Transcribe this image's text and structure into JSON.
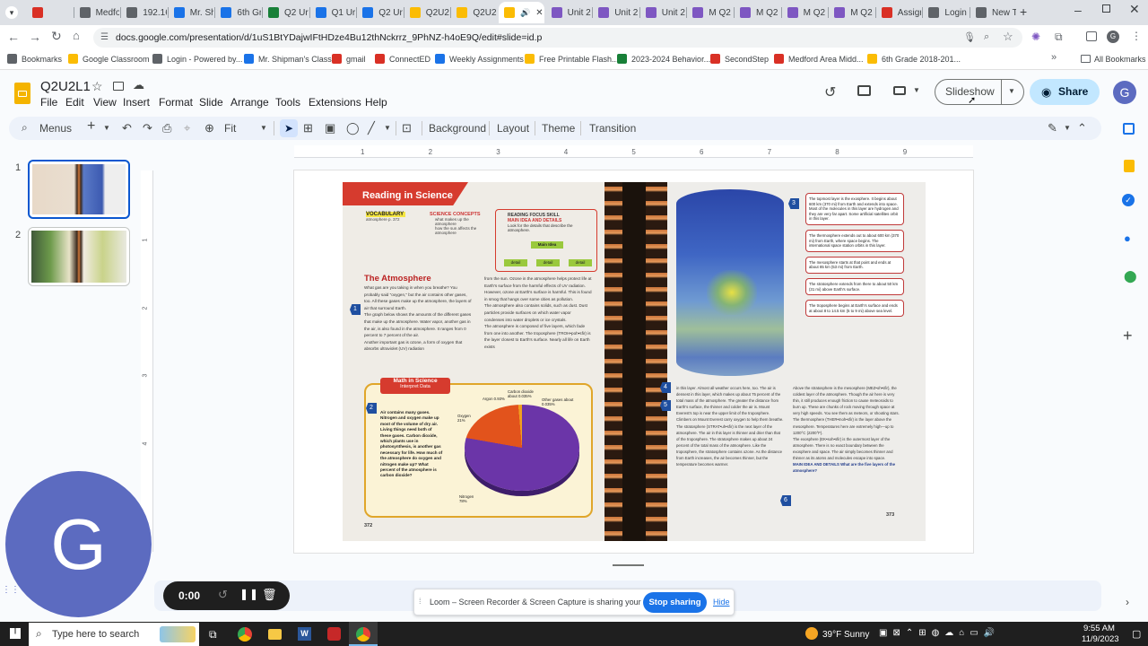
{
  "tabs": [
    {
      "label": "",
      "color": "#d93025"
    },
    {
      "label": "Medfo",
      "color": "#5f6368"
    },
    {
      "label": "192.16",
      "color": "#5f6368"
    },
    {
      "label": "Mr. Sh",
      "color": "#1a73e8"
    },
    {
      "label": "6th Gr",
      "color": "#1a73e8"
    },
    {
      "label": "Q2 Ur",
      "color": "#188038"
    },
    {
      "label": "Q1 Ur",
      "color": "#1a73e8"
    },
    {
      "label": "Q2 Ur",
      "color": "#1a73e8"
    },
    {
      "label": "Q2U2",
      "color": "#fbbc04"
    },
    {
      "label": "Q2U2",
      "color": "#fbbc04"
    },
    {
      "label": "",
      "color": "#fbbc04"
    },
    {
      "label": "Unit 2",
      "color": "#7e57c2"
    },
    {
      "label": "Unit 2",
      "color": "#7e57c2"
    },
    {
      "label": "Unit 2",
      "color": "#7e57c2"
    },
    {
      "label": "M Q2",
      "color": "#7e57c2"
    },
    {
      "label": "M Q2",
      "color": "#7e57c2"
    },
    {
      "label": "M Q2",
      "color": "#7e57c2"
    },
    {
      "label": "M Q2",
      "color": "#7e57c2"
    },
    {
      "label": "Assigr",
      "color": "#d93025"
    },
    {
      "label": "Login",
      "color": "#5f6368"
    },
    {
      "label": "New T",
      "color": "#5f6368"
    }
  ],
  "url": "docs.google.com/presentation/d/1uS1BtYDajwIFtHDze4Bu12thNckrrz_9PhNZ-h4oE9Q/edit#slide=id.p",
  "bookmarks": [
    {
      "label": "Bookmarks",
      "color": "#5f6368"
    },
    {
      "label": "Google Classroom",
      "color": "#fbbc04"
    },
    {
      "label": "Login - Powered by...",
      "color": "#5f6368"
    },
    {
      "label": "Mr. Shipman's Class",
      "color": "#1a73e8"
    },
    {
      "label": "gmail",
      "color": "#d93025"
    },
    {
      "label": "ConnectED",
      "color": "#d93025"
    },
    {
      "label": "Weekly Assignments",
      "color": "#1a73e8"
    },
    {
      "label": "Free Printable Flash...",
      "color": "#fbbc04"
    },
    {
      "label": "2023-2024 Behavior...",
      "color": "#188038"
    },
    {
      "label": "SecondStep",
      "color": "#d93025"
    },
    {
      "label": "Medford Area Midd...",
      "color": "#d93025"
    },
    {
      "label": "6th Grade 2018-201...",
      "color": "#fbbc04"
    }
  ],
  "all_bookmarks": "All Bookmarks",
  "doc_title": "Q2U2L1",
  "menus": [
    "File",
    "Edit",
    "View",
    "Insert",
    "Format",
    "Slide",
    "Arrange",
    "Tools",
    "Extensions",
    "Help"
  ],
  "slideshow_label": "Slideshow",
  "share_label": "Share",
  "account_initial": "G",
  "toolbar": {
    "menus": "Menus",
    "zoom": "Fit",
    "background": "Background",
    "layout": "Layout",
    "theme": "Theme",
    "transition": "Transition"
  },
  "slides": [
    "1",
    "2"
  ],
  "page": {
    "heading": "Reading in Science",
    "vocab_title": "VOCABULARY",
    "vocab_item": "atmosphere p. 372",
    "concepts_title": "SCIENCE CONCEPTS",
    "concept1": "what makes up the atmosphere",
    "concept2": "how the sun affects the atmosphere",
    "focus_title": "READING FOCUS SKILL",
    "focus_sub": "MAIN IDEA AND DETAILS",
    "focus_text": "Look for the details that describe the atmosphere.",
    "main_idea": "Main Idea",
    "detail": "detail",
    "atm_title": "The Atmosphere",
    "atm_para1": "What gas are you taking in when you breathe? You probably said \"oxygen,\" but the air contains other gases, too. All these gases make up the atmosphere, the layers of air that surround Earth.",
    "atm_para2": "The graph below shows the amounts of the different gases that make up the atmosphere. Water vapor, another gas in the air, is also found in the atmosphere. It ranges from 0 percent to 7 percent of the air.",
    "atm_para3": "Another important gas is ozone, a form of oxygen that absorbs ultraviolet (UV) radiation",
    "col2_para1": "from the sun. Ozone in the atmosphere helps protect life at Earth's surface from the harmful effects of UV radiation. However, ozone at Earth's surface is harmful. This is found in smog that hangs over some cities as pollution.",
    "col2_para2": "The atmosphere also contains solids, such as dust. Dust particles provide surfaces on which water vapor condenses into water droplets or ice crystals.",
    "col2_para3": "The atmosphere is composed of five layers, which fade from one into another. The troposphere (TROH•poh•sfir) is the layer closest to Earth's surface. Nearly all life on Earth exists",
    "math_title": "Math in Science",
    "math_sub": "Interpret Data",
    "math_text": "Air contains many gases. Nitrogen and oxygen make up most of the volume of dry air. Living things need both of these gases. Carbon dioxide, which plants use in photosynthesis, is another gas necessary for life. How much of the atmosphere do oxygen and nitrogen make up? What percent of the atmosphere is carbon dioxide?",
    "pie": {
      "argon": "Argon 0.93%",
      "co2": "Carbon dioxide about 0.035%",
      "other": "Other gases about 0.035%",
      "oxygen": "Oxygen 21%",
      "nitrogen": "Nitrogen 78%"
    },
    "page_left": "372",
    "page_right": "373",
    "layer3": "The topmost layer is the exosphere. It begins about 600 km (370 mi) from Earth and extends into space. Most of the molecules in this layer are hydrogen and they are very far apart. Some artificial satellites orbit in this layer.",
    "layer_thermo": "The thermosphere extends out to about 600 km (370 mi) from Earth, where space begins. The international space station orbits in this layer.",
    "layer_meso": "The mesosphere starts at that point and ends at about 85 km (53 mi) from Earth.",
    "layer_strato": "The stratosphere extends from there to about 50 km (31 mi) above Earth's surface.",
    "layer_tropo": "The troposphere begins at Earth's surface and ends at about 8 to 14.5 km (5 to 9 mi) above sea level.",
    "right_col1": "in this layer. Almost all weather occurs here, too. The air is densest in this layer, which makes up about 75 percent of the total mass of the atmosphere. The greater the distance from Earth's surface, the thinner and colder the air is. Mount Everest's top is near the upper limit of the troposphere. Climbers on Mount Everest carry oxygen to help them breathe.",
    "right_col1b": "The stratosphere (STRAT•uh•sfir) is the next layer of the atmosphere. The air in this layer is thinner and drier than that of the troposphere. The stratosphere makes up about 24 percent of the total mass of the atmosphere. Like the troposphere, the stratosphere contains ozone. As the distance from Earth increases, the air becomes thinner, but the temperature becomes warmer.",
    "right_col2": "Above the stratosphere is the mesosphere (MEZ•oh•sfir), the coldest layer of the atmosphere. Though the air here is very thin, it still produces enough friction to cause meteoroids to burn up. These are chunks of rock moving through space at very high speeds. You see them as meteors, or shooting stars.",
    "right_col2b": "The thermosphere (THER•moh•sfir) is the layer above the mesosphere. Temperatures here are extremely high—up to 1200°C (2200°F).",
    "right_col2c": "The exosphere (EK•soh•sfir) is the outermost layer of the atmosphere. There is no exact boundary between the exosphere and space. The air simply becomes thinner and thinner as its atoms and molecules escape into space.",
    "main_idea_q": "MAIN IDEA AND DETAILS What are the five layers of the atmosphere?",
    "markers": [
      "1",
      "2",
      "3",
      "4",
      "5",
      "6"
    ]
  },
  "recorder": {
    "time": "0:00"
  },
  "loom": {
    "message": "Loom – Screen Recorder & Screen Capture is sharing your screen.",
    "stop": "Stop sharing",
    "hide": "Hide"
  },
  "webcam_initial": "G",
  "taskbar": {
    "search": "Type here to search",
    "weather": "39°F  Sunny",
    "time": "9:55 AM",
    "date": "11/9/2023"
  },
  "ruler": [
    "1",
    "2",
    "3",
    "4",
    "5",
    "6",
    "7",
    "8",
    "9"
  ],
  "vruler": [
    "1",
    "2",
    "3",
    "4"
  ]
}
